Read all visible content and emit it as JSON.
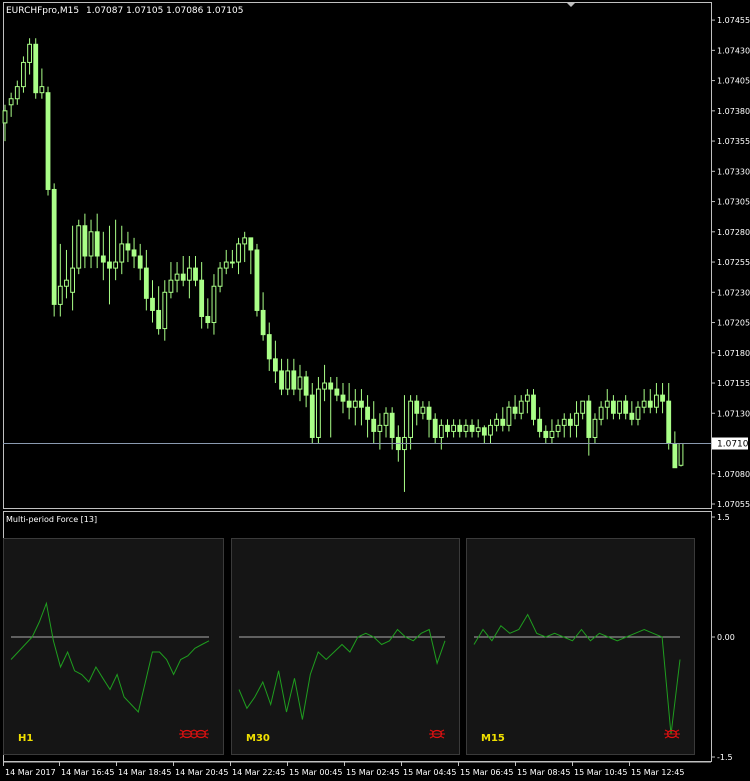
{
  "header": {
    "symbol": "EURCHFpro,M15",
    "quote": "1.07087 1.07105 1.07086 1.07105"
  },
  "main_axis": {
    "labels": [
      "1.07455",
      "1.07430",
      "1.07405",
      "1.07380",
      "1.07355",
      "1.07330",
      "1.07305",
      "1.07280",
      "1.07255",
      "1.07230",
      "1.07205",
      "1.07180",
      "1.07155",
      "1.07130",
      "1.07080",
      "1.07055"
    ],
    "current_price": "1.07105"
  },
  "indicator": {
    "title": "Multi-period Force [13]",
    "axis_labels": [
      "1.5",
      "0.00",
      "-1.5"
    ],
    "panels": [
      {
        "label": "H1",
        "icon": "bug-icon"
      },
      {
        "label": "M30",
        "icon": "bug-icon"
      },
      {
        "label": "M15",
        "icon": "bug-icon"
      }
    ]
  },
  "time_axis": [
    "14 Mar 2017",
    "14 Mar 16:45",
    "14 Mar 18:45",
    "14 Mar 20:45",
    "14 Mar 22:45",
    "15 Mar 00:45",
    "15 Mar 02:45",
    "15 Mar 04:45",
    "15 Mar 06:45",
    "15 Mar 08:45",
    "15 Mar 10:45",
    "15 Mar 12:45"
  ],
  "colors": {
    "background": "#000000",
    "candle": "#aaff88",
    "force_line": "#1f9e1f",
    "zero_line": "#aaaaaa",
    "panel_bg": "#151515",
    "panel_border": "#3a3a3a",
    "panel_label": "#f0e000",
    "bug": "#e01010",
    "grid_border": "#c0c0c0"
  },
  "chart_data": [
    {
      "type": "candlestick",
      "title": "EURCHFpro,M15",
      "ylim": [
        1.07055,
        1.07465
      ],
      "candles": [
        [
          1.0737,
          1.0738,
          1.07355,
          1.07385
        ],
        [
          1.07385,
          1.0739,
          1.07375,
          1.07395
        ],
        [
          1.0739,
          1.074,
          1.07385,
          1.07405
        ],
        [
          1.074,
          1.0742,
          1.07395,
          1.07425
        ],
        [
          1.0742,
          1.07435,
          1.0741,
          1.0744
        ],
        [
          1.07435,
          1.07395,
          1.0739,
          1.0744
        ],
        [
          1.07395,
          1.074,
          1.0739,
          1.07415
        ],
        [
          1.07395,
          1.07315,
          1.0731,
          1.074
        ],
        [
          1.07315,
          1.0722,
          1.0721,
          1.0732
        ],
        [
          1.0722,
          1.07235,
          1.0721,
          1.0727
        ],
        [
          1.07235,
          1.0724,
          1.07225,
          1.07265
        ],
        [
          1.0723,
          1.0725,
          1.07215,
          1.07285
        ],
        [
          1.0725,
          1.07285,
          1.07245,
          1.0729
        ],
        [
          1.07285,
          1.0726,
          1.0725,
          1.07295
        ],
        [
          1.0726,
          1.0728,
          1.0725,
          1.0729
        ],
        [
          1.0728,
          1.0726,
          1.0725,
          1.07295
        ],
        [
          1.0726,
          1.07255,
          1.0724,
          1.0728
        ],
        [
          1.07255,
          1.0725,
          1.0722,
          1.07285
        ],
        [
          1.0725,
          1.07255,
          1.0724,
          1.0729
        ],
        [
          1.07255,
          1.0727,
          1.07245,
          1.07285
        ],
        [
          1.0727,
          1.07265,
          1.07255,
          1.0728
        ],
        [
          1.07265,
          1.0726,
          1.0725,
          1.07275
        ],
        [
          1.0726,
          1.0725,
          1.0724,
          1.0727
        ],
        [
          1.0725,
          1.07225,
          1.07215,
          1.07265
        ],
        [
          1.07225,
          1.07215,
          1.07205,
          1.0724
        ],
        [
          1.07215,
          1.072,
          1.07195,
          1.07235
        ],
        [
          1.072,
          1.0723,
          1.0719,
          1.0724
        ],
        [
          1.0723,
          1.0724,
          1.07225,
          1.07255
        ],
        [
          1.0724,
          1.07245,
          1.0723,
          1.07255
        ],
        [
          1.07245,
          1.0724,
          1.07235,
          1.0726
        ],
        [
          1.0724,
          1.0725,
          1.07225,
          1.0726
        ],
        [
          1.0725,
          1.0724,
          1.07235,
          1.0726
        ],
        [
          1.0724,
          1.0721,
          1.072,
          1.07255
        ],
        [
          1.0721,
          1.07205,
          1.072,
          1.07225
        ],
        [
          1.07205,
          1.07235,
          1.07195,
          1.07245
        ],
        [
          1.07235,
          1.0725,
          1.0723,
          1.07255
        ],
        [
          1.0725,
          1.07255,
          1.07245,
          1.07265
        ],
        [
          1.07255,
          1.07255,
          1.0725,
          1.07265
        ],
        [
          1.07255,
          1.0727,
          1.07245,
          1.07275
        ],
        [
          1.0727,
          1.07275,
          1.07255,
          1.0728
        ],
        [
          1.07275,
          1.07265,
          1.07245,
          1.07275
        ],
        [
          1.07265,
          1.07215,
          1.0721,
          1.0727
        ],
        [
          1.07215,
          1.07195,
          1.0719,
          1.0723
        ],
        [
          1.07195,
          1.07175,
          1.07165,
          1.07205
        ],
        [
          1.07175,
          1.07165,
          1.07155,
          1.0719
        ],
        [
          1.07165,
          1.0715,
          1.07145,
          1.07175
        ],
        [
          1.0715,
          1.07165,
          1.07145,
          1.07175
        ],
        [
          1.07165,
          1.0715,
          1.07145,
          1.07175
        ],
        [
          1.0715,
          1.0716,
          1.0714,
          1.0717
        ],
        [
          1.0716,
          1.07145,
          1.07135,
          1.07165
        ],
        [
          1.07145,
          1.0711,
          1.07105,
          1.07155
        ],
        [
          1.0711,
          1.0715,
          1.07105,
          1.0716
        ],
        [
          1.0715,
          1.07155,
          1.0714,
          1.0717
        ],
        [
          1.07155,
          1.0715,
          1.0711,
          1.0716
        ],
        [
          1.0715,
          1.07145,
          1.0714,
          1.0716
        ],
        [
          1.07145,
          1.0714,
          1.0713,
          1.07155
        ],
        [
          1.0714,
          1.07135,
          1.07125,
          1.07155
        ],
        [
          1.07135,
          1.0714,
          1.0712,
          1.0715
        ],
        [
          1.0714,
          1.07135,
          1.0712,
          1.0715
        ],
        [
          1.07135,
          1.07125,
          1.0711,
          1.07145
        ],
        [
          1.07125,
          1.07115,
          1.07105,
          1.0714
        ],
        [
          1.07115,
          1.0712,
          1.071,
          1.0713
        ],
        [
          1.0712,
          1.0713,
          1.0711,
          1.07135
        ],
        [
          1.0713,
          1.0711,
          1.071,
          1.07135
        ],
        [
          1.0711,
          1.071,
          1.0709,
          1.0712
        ],
        [
          1.071,
          1.0711,
          1.07065,
          1.07145
        ],
        [
          1.0711,
          1.0714,
          1.071,
          1.07145
        ],
        [
          1.0714,
          1.0713,
          1.0712,
          1.07145
        ],
        [
          1.0713,
          1.07135,
          1.07125,
          1.0714
        ],
        [
          1.07135,
          1.07125,
          1.0711,
          1.0714
        ],
        [
          1.07125,
          1.0711,
          1.07105,
          1.0713
        ],
        [
          1.0711,
          1.0712,
          1.071,
          1.07125
        ],
        [
          1.0712,
          1.07115,
          1.0711,
          1.07125
        ],
        [
          1.07115,
          1.0712,
          1.0711,
          1.07125
        ],
        [
          1.0712,
          1.07115,
          1.0711,
          1.07125
        ],
        [
          1.07115,
          1.0712,
          1.0711,
          1.07125
        ],
        [
          1.0712,
          1.07115,
          1.0711,
          1.07125
        ],
        [
          1.07115,
          1.07118,
          1.0711,
          1.07125
        ],
        [
          1.07118,
          1.07112,
          1.07105,
          1.0712
        ],
        [
          1.07112,
          1.0712,
          1.07105,
          1.07125
        ],
        [
          1.0712,
          1.07125,
          1.07115,
          1.0713
        ],
        [
          1.07125,
          1.0712,
          1.07115,
          1.07135
        ],
        [
          1.0712,
          1.07135,
          1.07115,
          1.0714
        ],
        [
          1.07135,
          1.0713,
          1.07125,
          1.07145
        ],
        [
          1.0713,
          1.0714,
          1.07125,
          1.07145
        ],
        [
          1.0714,
          1.07145,
          1.0713,
          1.0715
        ],
        [
          1.07145,
          1.07125,
          1.0712,
          1.0715
        ],
        [
          1.07125,
          1.07115,
          1.0711,
          1.07135
        ],
        [
          1.07115,
          1.0711,
          1.07105,
          1.0712
        ],
        [
          1.0711,
          1.07115,
          1.07105,
          1.07125
        ],
        [
          1.07115,
          1.0712,
          1.0711,
          1.07125
        ],
        [
          1.0712,
          1.07125,
          1.0711,
          1.0713
        ],
        [
          1.07125,
          1.0712,
          1.0711,
          1.0713
        ],
        [
          1.0712,
          1.0713,
          1.0711,
          1.0714
        ],
        [
          1.0713,
          1.0714,
          1.07125,
          1.0714
        ],
        [
          1.0714,
          1.0711,
          1.07095,
          1.07145
        ],
        [
          1.0711,
          1.07125,
          1.07105,
          1.0713
        ],
        [
          1.07125,
          1.07135,
          1.0712,
          1.0714
        ],
        [
          1.07135,
          1.0714,
          1.07125,
          1.0715
        ],
        [
          1.0714,
          1.0713,
          1.07125,
          1.07145
        ],
        [
          1.0713,
          1.0714,
          1.07125,
          1.0714
        ],
        [
          1.0714,
          1.0713,
          1.07125,
          1.07145
        ],
        [
          1.0713,
          1.07125,
          1.0712,
          1.0714
        ],
        [
          1.07125,
          1.07135,
          1.0712,
          1.0714
        ],
        [
          1.07135,
          1.0714,
          1.0713,
          1.0715
        ],
        [
          1.0714,
          1.07135,
          1.0713,
          1.0715
        ],
        [
          1.07135,
          1.07145,
          1.0713,
          1.07155
        ],
        [
          1.07145,
          1.0714,
          1.0713,
          1.07155
        ],
        [
          1.0714,
          1.07105,
          1.071,
          1.07155
        ],
        [
          1.07105,
          1.07085,
          1.07085,
          1.07115
        ],
        [
          1.07087,
          1.07105,
          1.07086,
          1.07105
        ]
      ]
    },
    {
      "type": "line",
      "title": "Multi-period Force [13]",
      "ylim": [
        -1.5,
        1.5
      ],
      "series": [
        {
          "name": "H1",
          "values": [
            -0.3,
            -0.2,
            -0.1,
            0.0,
            0.2,
            0.45,
            -0.05,
            -0.4,
            -0.2,
            -0.45,
            -0.5,
            -0.6,
            -0.4,
            -0.55,
            -0.7,
            -0.5,
            -0.8,
            -0.9,
            -1.0,
            -0.6,
            -0.2,
            -0.2,
            -0.3,
            -0.5,
            -0.3,
            -0.25,
            -0.15,
            -0.1,
            -0.05
          ]
        },
        {
          "name": "M30",
          "values": [
            -0.7,
            -0.95,
            -0.8,
            -0.6,
            -0.9,
            -0.45,
            -1.0,
            -0.55,
            -1.1,
            -0.5,
            -0.2,
            -0.3,
            -0.2,
            -0.1,
            -0.2,
            0.0,
            0.05,
            0.0,
            -0.1,
            -0.05,
            0.1,
            0.0,
            -0.05,
            0.05,
            0.1,
            -0.35,
            -0.05
          ]
        },
        {
          "name": "M15",
          "values": [
            -0.1,
            0.1,
            -0.05,
            0.15,
            0.05,
            0.1,
            0.3,
            0.05,
            0.0,
            0.05,
            0.0,
            -0.05,
            0.1,
            -0.05,
            0.05,
            0.0,
            -0.05,
            0.0,
            0.05,
            0.1,
            0.05,
            0.0,
            -1.3,
            -0.3
          ]
        }
      ]
    }
  ]
}
